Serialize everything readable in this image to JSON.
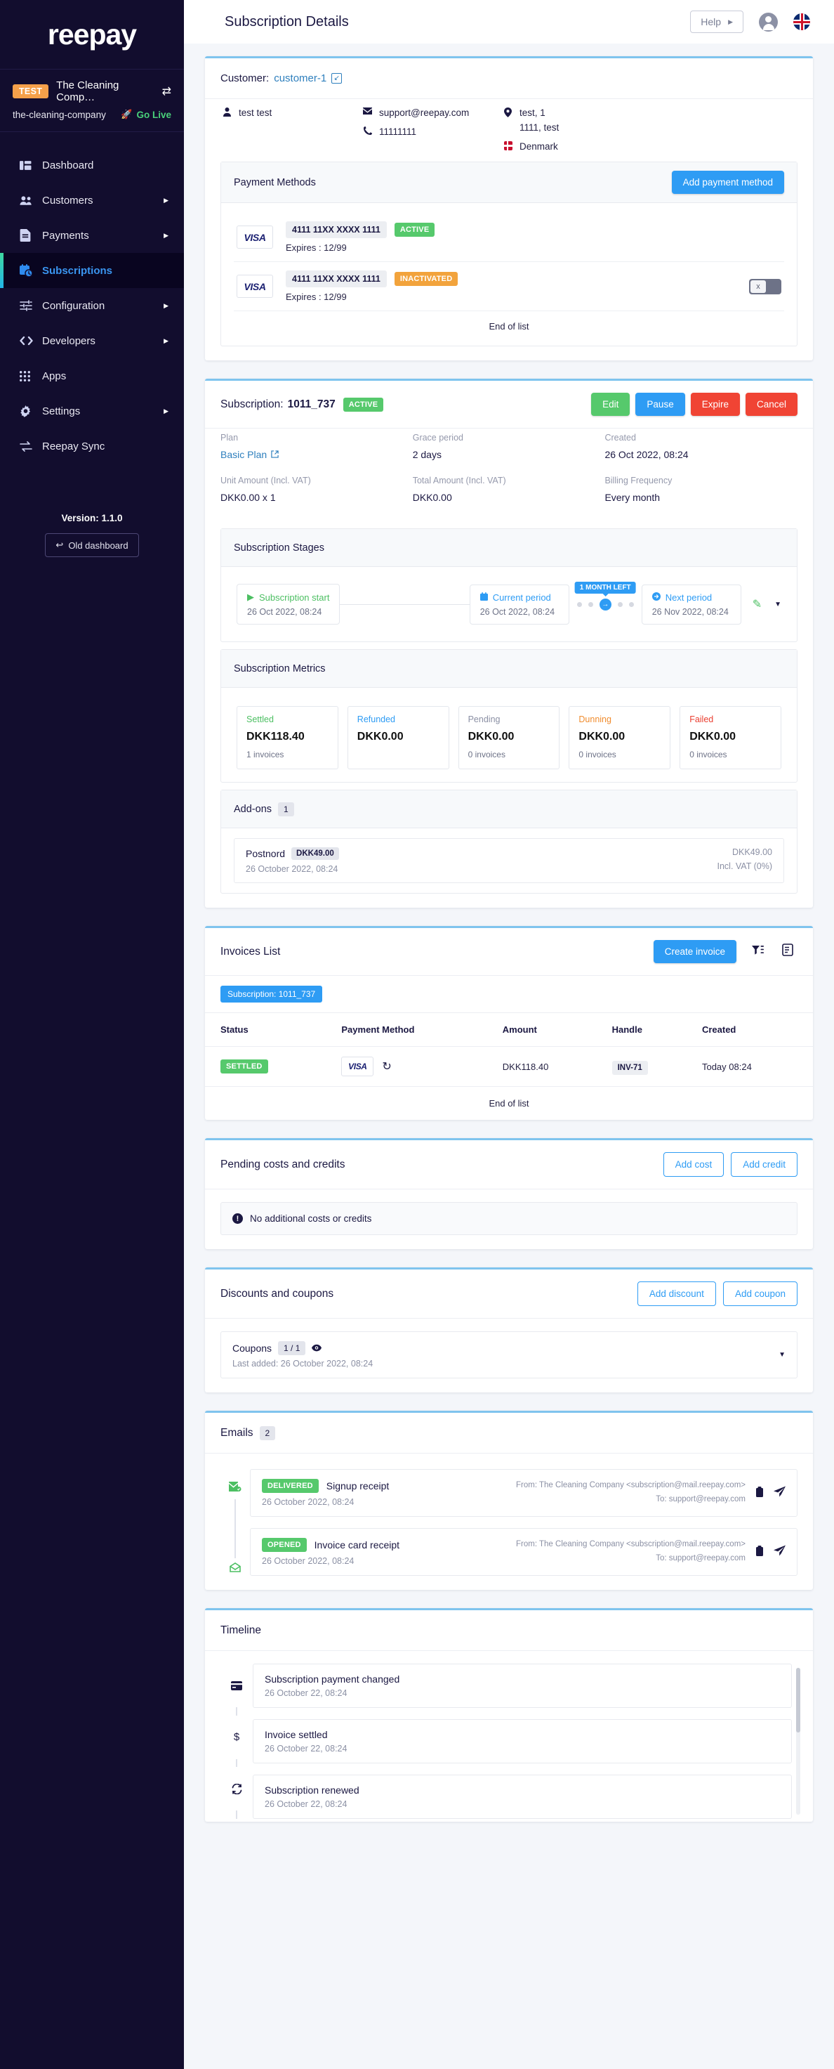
{
  "sidebar": {
    "brand": "reepay",
    "tenant": {
      "badge": "TEST",
      "name": "The Cleaning Comp…",
      "handle": "the-cleaning-company",
      "go_live": "Go Live"
    },
    "items": [
      {
        "label": "Dashboard",
        "icon": "dashboard-icon",
        "has_caret": false,
        "active": false
      },
      {
        "label": "Customers",
        "icon": "customers-icon",
        "has_caret": true,
        "active": false
      },
      {
        "label": "Payments",
        "icon": "payments-icon",
        "has_caret": true,
        "active": false
      },
      {
        "label": "Subscriptions",
        "icon": "subscriptions-icon",
        "has_caret": false,
        "active": true
      },
      {
        "label": "Configuration",
        "icon": "configuration-icon",
        "has_caret": true,
        "active": false
      },
      {
        "label": "Developers",
        "icon": "developers-icon",
        "has_caret": true,
        "active": false
      },
      {
        "label": "Apps",
        "icon": "apps-icon",
        "has_caret": false,
        "active": false
      },
      {
        "label": "Settings",
        "icon": "settings-icon",
        "has_caret": true,
        "active": false
      },
      {
        "label": "Reepay Sync",
        "icon": "sync-icon",
        "has_caret": false,
        "active": false
      }
    ],
    "version": "Version: 1.1.0",
    "old_dashboard": "Old dashboard"
  },
  "topbar": {
    "title": "Subscription Details",
    "help": "Help",
    "account_icon": "account-icon",
    "language_icon": "uk-flag-icon"
  },
  "customer_card": {
    "label": "Customer:",
    "handle": "customer-1",
    "name": "test test",
    "email": "support@reepay.com",
    "phone": "11111111",
    "address_line1": "test, 1",
    "address_line2": "1111, test",
    "country": "Denmark",
    "payment_methods": {
      "title": "Payment Methods",
      "add_button": "Add payment method",
      "rows": [
        {
          "brand": "VISA",
          "number": "4111 11XX XXXX 1111",
          "status": "ACTIVE",
          "status_color": "green",
          "expires": "Expires : 12/99",
          "has_toggle": false
        },
        {
          "brand": "VISA",
          "number": "4111 11XX XXXX 1111",
          "status": "INACTIVATED",
          "status_color": "orange",
          "expires": "Expires : 12/99",
          "has_toggle": true,
          "toggle_label": "x"
        }
      ],
      "end_of_list": "End of list"
    }
  },
  "subscription": {
    "label": "Subscription:",
    "handle": "1011_737",
    "status": "ACTIVE",
    "actions": [
      {
        "label": "Edit",
        "style": "green"
      },
      {
        "label": "Pause",
        "style": "blue"
      },
      {
        "label": "Expire",
        "style": "red"
      },
      {
        "label": "Cancel",
        "style": "red"
      }
    ],
    "fields": [
      {
        "label": "Plan",
        "value": "Basic Plan",
        "is_link": true
      },
      {
        "label": "Grace period",
        "value": "2 days",
        "is_link": false
      },
      {
        "label": "Created",
        "value": "26 Oct 2022, 08:24",
        "is_link": false
      },
      {
        "label": "Unit Amount (Incl. VAT)",
        "value": "DKK0.00 x 1",
        "is_link": false
      },
      {
        "label": "Total Amount (Incl. VAT)",
        "value": "DKK0.00",
        "is_link": false
      },
      {
        "label": "Billing Frequency",
        "value": "Every month",
        "is_link": false
      }
    ],
    "stages": {
      "title": "Subscription Stages",
      "start": {
        "name": "Subscription start",
        "date": "26 Oct 2022, 08:24"
      },
      "current": {
        "name": "Current period",
        "date": "26 Oct 2022, 08:24"
      },
      "tooltip": "1 MONTH LEFT",
      "next": {
        "name": "Next period",
        "date": "26 Nov 2022, 08:24"
      }
    },
    "metrics": {
      "title": "Subscription Metrics",
      "items": [
        {
          "label": "Settled",
          "value": "DKK118.40",
          "sub": "1 invoices",
          "color": "settled"
        },
        {
          "label": "Refunded",
          "value": "DKK0.00",
          "sub": "",
          "color": "refunded"
        },
        {
          "label": "Pending",
          "value": "DKK0.00",
          "sub": "0 invoices",
          "color": "pending"
        },
        {
          "label": "Dunning",
          "value": "DKK0.00",
          "sub": "0 invoices",
          "color": "dunning"
        },
        {
          "label": "Failed",
          "value": "DKK0.00",
          "sub": "0 invoices",
          "color": "failed"
        }
      ]
    },
    "addons": {
      "title": "Add-ons",
      "count": "1",
      "rows": [
        {
          "name": "Postnord",
          "price_chip": "DKK49.00",
          "date": "26 October 2022, 08:24",
          "amount": "DKK49.00",
          "vat": "Incl. VAT (0%)"
        }
      ]
    }
  },
  "invoices": {
    "title": "Invoices List",
    "create_button": "Create invoice",
    "filter_icon": "filter-icon",
    "columns_icon": "columns-icon",
    "filter_chip": "Subscription: 1011_737",
    "headers": [
      "Status",
      "Payment Method",
      "Amount",
      "Handle",
      "Created"
    ],
    "rows": [
      {
        "status": "SETTLED",
        "payment_method": "VISA",
        "recurring_icon": "recurring-icon",
        "amount": "DKK118.40",
        "handle": "INV-71",
        "created": "Today 08:24"
      }
    ],
    "end_of_list": "End of list"
  },
  "pending_costs": {
    "title": "Pending costs and credits",
    "add_cost": "Add cost",
    "add_credit": "Add credit",
    "empty_message": "No additional costs or credits"
  },
  "discounts": {
    "title": "Discounts and coupons",
    "add_discount": "Add discount",
    "add_coupon": "Add coupon",
    "coupon_label": "Coupons",
    "coupon_count": "1 / 1",
    "coupon_sub": "Last added: 26 October 2022, 08:24"
  },
  "emails": {
    "title": "Emails",
    "count": "2",
    "rows": [
      {
        "status": "DELIVERED",
        "subject": "Signup receipt",
        "date": "26 October 2022, 08:24",
        "from": "From: The Cleaning Company <subscription@mail.reepay.com>",
        "to": "To: support@reepay.com",
        "rail_icon": "mail-delivered-icon"
      },
      {
        "status": "OPENED",
        "subject": "Invoice card receipt",
        "date": "26 October 2022, 08:24",
        "from": "From: The Cleaning Company <subscription@mail.reepay.com>",
        "to": "To: support@reepay.com",
        "rail_icon": "mail-opened-icon"
      }
    ]
  },
  "timeline": {
    "title": "Timeline",
    "items": [
      {
        "title": "Subscription payment changed",
        "date": "26 October 22, 08:24",
        "icon": "card-icon"
      },
      {
        "title": "Invoice settled",
        "date": "26 October 22, 08:24",
        "icon": "dollar-icon"
      },
      {
        "title": "Subscription renewed",
        "date": "26 October 22, 08:24",
        "icon": "renew-icon"
      }
    ]
  }
}
